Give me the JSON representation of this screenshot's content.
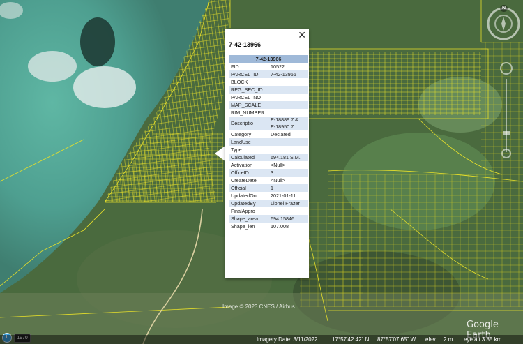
{
  "balloon": {
    "title": "7-42-13966",
    "close_glyph": "✕",
    "table_header": "7-42-13966",
    "rows": [
      {
        "key": "FID",
        "value": "10522"
      },
      {
        "key": "PARCEL_ID",
        "value": "7-42-13966"
      },
      {
        "key": "BLOCK",
        "value": ""
      },
      {
        "key": "REG_SEC_ID",
        "value": ""
      },
      {
        "key": "PARCEL_NO",
        "value": ""
      },
      {
        "key": "MAP_SCALE",
        "value": ""
      },
      {
        "key": "RIM_NUMBER",
        "value": ""
      },
      {
        "key": "Descriptio",
        "value": "E-18889 7 &",
        "value2": "E-18950 7"
      },
      {
        "key": "Category",
        "value": "Declared"
      },
      {
        "key": "LandUse",
        "value": ""
      },
      {
        "key": "Type",
        "value": ""
      },
      {
        "key": "Calculated",
        "value": "694.181 S.M."
      },
      {
        "key": "Activation",
        "value": "<Null>"
      },
      {
        "key": "OfficeID",
        "value": "3"
      },
      {
        "key": "CreateDate",
        "value": "<Null>"
      },
      {
        "key": "Official",
        "value": "1"
      },
      {
        "key": "UpdatedOn",
        "value": "2021-01-11"
      },
      {
        "key": "UpdatedBy",
        "value": "Lionel Frazer"
      },
      {
        "key": "FinalAppro",
        "value": ""
      },
      {
        "key": "Shape_area",
        "value": "694.15846"
      },
      {
        "key": "Shape_len",
        "value": "107.008"
      }
    ]
  },
  "map": {
    "copyright": "Image © 2023 CNES / Airbus",
    "brand": "Google Earth",
    "north_label": "N",
    "parcel_line_color": "#e8e02a"
  },
  "status_bar": {
    "historical_year": "1970",
    "imagery_date": "Imagery Date: 3/11/2022",
    "lat": "17°57'42.42\" N",
    "lon": "87°57'07.65\" W",
    "elev_label": "elev",
    "elev_value": "2 m",
    "eye_alt": "eye alt   3.85 km"
  }
}
